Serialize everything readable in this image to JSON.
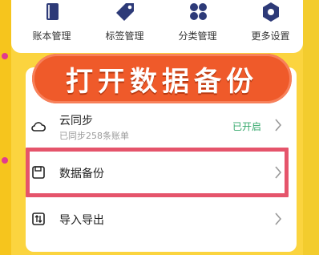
{
  "top_grid": {
    "items": [
      {
        "label": "账本管理",
        "icon": "book-icon"
      },
      {
        "label": "标签管理",
        "icon": "tag-icon"
      },
      {
        "label": "分类管理",
        "icon": "category-grid-icon"
      },
      {
        "label": "更多设置",
        "icon": "settings-gear-icon"
      }
    ]
  },
  "banner": {
    "text": "打开数据备份"
  },
  "list": {
    "cloud_sync": {
      "title": "云同步",
      "subtitle": "已同步258条账单",
      "status": "已开启"
    },
    "data_backup": {
      "title": "数据备份"
    },
    "import_export": {
      "title": "导入导出"
    }
  },
  "colors": {
    "background": "#fbd43f",
    "icon_navy": "#2d3a78",
    "highlight_border": "#e5546b",
    "banner": "#ef5a2a",
    "status_green": "#35a86b"
  }
}
